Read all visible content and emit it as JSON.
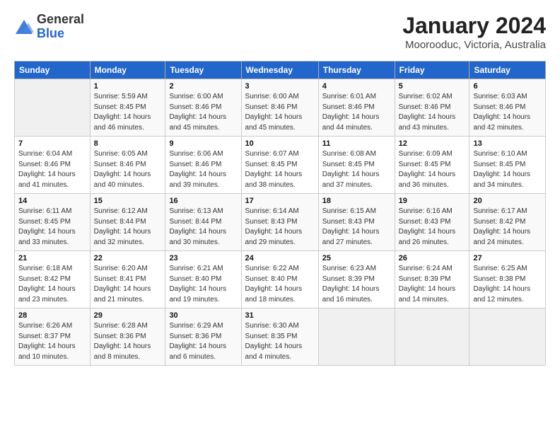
{
  "header": {
    "logo_general": "General",
    "logo_blue": "Blue",
    "title": "January 2024",
    "subtitle": "Moorooduc, Victoria, Australia"
  },
  "columns": [
    "Sunday",
    "Monday",
    "Tuesday",
    "Wednesday",
    "Thursday",
    "Friday",
    "Saturday"
  ],
  "weeks": [
    [
      {
        "num": "",
        "info": ""
      },
      {
        "num": "1",
        "info": "Sunrise: 5:59 AM\nSunset: 8:45 PM\nDaylight: 14 hours\nand 46 minutes."
      },
      {
        "num": "2",
        "info": "Sunrise: 6:00 AM\nSunset: 8:46 PM\nDaylight: 14 hours\nand 45 minutes."
      },
      {
        "num": "3",
        "info": "Sunrise: 6:00 AM\nSunset: 8:46 PM\nDaylight: 14 hours\nand 45 minutes."
      },
      {
        "num": "4",
        "info": "Sunrise: 6:01 AM\nSunset: 8:46 PM\nDaylight: 14 hours\nand 44 minutes."
      },
      {
        "num": "5",
        "info": "Sunrise: 6:02 AM\nSunset: 8:46 PM\nDaylight: 14 hours\nand 43 minutes."
      },
      {
        "num": "6",
        "info": "Sunrise: 6:03 AM\nSunset: 8:46 PM\nDaylight: 14 hours\nand 42 minutes."
      }
    ],
    [
      {
        "num": "7",
        "info": "Sunrise: 6:04 AM\nSunset: 8:46 PM\nDaylight: 14 hours\nand 41 minutes."
      },
      {
        "num": "8",
        "info": "Sunrise: 6:05 AM\nSunset: 8:46 PM\nDaylight: 14 hours\nand 40 minutes."
      },
      {
        "num": "9",
        "info": "Sunrise: 6:06 AM\nSunset: 8:46 PM\nDaylight: 14 hours\nand 39 minutes."
      },
      {
        "num": "10",
        "info": "Sunrise: 6:07 AM\nSunset: 8:45 PM\nDaylight: 14 hours\nand 38 minutes."
      },
      {
        "num": "11",
        "info": "Sunrise: 6:08 AM\nSunset: 8:45 PM\nDaylight: 14 hours\nand 37 minutes."
      },
      {
        "num": "12",
        "info": "Sunrise: 6:09 AM\nSunset: 8:45 PM\nDaylight: 14 hours\nand 36 minutes."
      },
      {
        "num": "13",
        "info": "Sunrise: 6:10 AM\nSunset: 8:45 PM\nDaylight: 14 hours\nand 34 minutes."
      }
    ],
    [
      {
        "num": "14",
        "info": "Sunrise: 6:11 AM\nSunset: 8:45 PM\nDaylight: 14 hours\nand 33 minutes."
      },
      {
        "num": "15",
        "info": "Sunrise: 6:12 AM\nSunset: 8:44 PM\nDaylight: 14 hours\nand 32 minutes."
      },
      {
        "num": "16",
        "info": "Sunrise: 6:13 AM\nSunset: 8:44 PM\nDaylight: 14 hours\nand 30 minutes."
      },
      {
        "num": "17",
        "info": "Sunrise: 6:14 AM\nSunset: 8:43 PM\nDaylight: 14 hours\nand 29 minutes."
      },
      {
        "num": "18",
        "info": "Sunrise: 6:15 AM\nSunset: 8:43 PM\nDaylight: 14 hours\nand 27 minutes."
      },
      {
        "num": "19",
        "info": "Sunrise: 6:16 AM\nSunset: 8:43 PM\nDaylight: 14 hours\nand 26 minutes."
      },
      {
        "num": "20",
        "info": "Sunrise: 6:17 AM\nSunset: 8:42 PM\nDaylight: 14 hours\nand 24 minutes."
      }
    ],
    [
      {
        "num": "21",
        "info": "Sunrise: 6:18 AM\nSunset: 8:42 PM\nDaylight: 14 hours\nand 23 minutes."
      },
      {
        "num": "22",
        "info": "Sunrise: 6:20 AM\nSunset: 8:41 PM\nDaylight: 14 hours\nand 21 minutes."
      },
      {
        "num": "23",
        "info": "Sunrise: 6:21 AM\nSunset: 8:40 PM\nDaylight: 14 hours\nand 19 minutes."
      },
      {
        "num": "24",
        "info": "Sunrise: 6:22 AM\nSunset: 8:40 PM\nDaylight: 14 hours\nand 18 minutes."
      },
      {
        "num": "25",
        "info": "Sunrise: 6:23 AM\nSunset: 8:39 PM\nDaylight: 14 hours\nand 16 minutes."
      },
      {
        "num": "26",
        "info": "Sunrise: 6:24 AM\nSunset: 8:39 PM\nDaylight: 14 hours\nand 14 minutes."
      },
      {
        "num": "27",
        "info": "Sunrise: 6:25 AM\nSunset: 8:38 PM\nDaylight: 14 hours\nand 12 minutes."
      }
    ],
    [
      {
        "num": "28",
        "info": "Sunrise: 6:26 AM\nSunset: 8:37 PM\nDaylight: 14 hours\nand 10 minutes."
      },
      {
        "num": "29",
        "info": "Sunrise: 6:28 AM\nSunset: 8:36 PM\nDaylight: 14 hours\nand 8 minutes."
      },
      {
        "num": "30",
        "info": "Sunrise: 6:29 AM\nSunset: 8:36 PM\nDaylight: 14 hours\nand 6 minutes."
      },
      {
        "num": "31",
        "info": "Sunrise: 6:30 AM\nSunset: 8:35 PM\nDaylight: 14 hours\nand 4 minutes."
      },
      {
        "num": "",
        "info": ""
      },
      {
        "num": "",
        "info": ""
      },
      {
        "num": "",
        "info": ""
      }
    ]
  ]
}
